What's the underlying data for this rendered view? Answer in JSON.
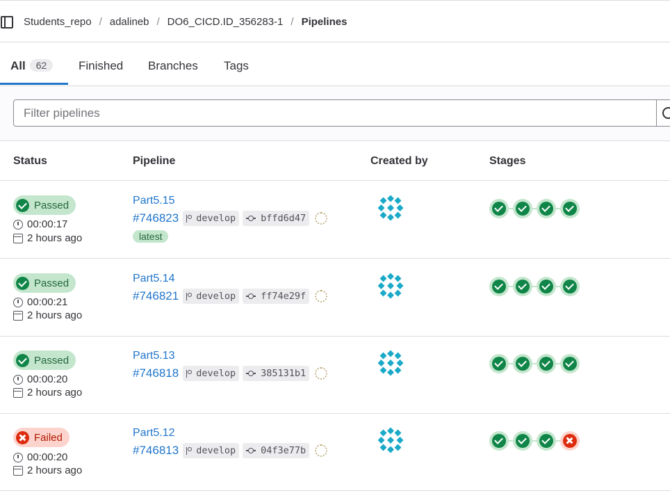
{
  "breadcrumb": {
    "items": [
      "Students_repo",
      "adalineb",
      "DO6_CICD.ID_356283-1",
      "Pipelines"
    ]
  },
  "tabs": {
    "all_label": "All",
    "all_count": "62",
    "finished_label": "Finished",
    "branches_label": "Branches",
    "tags_label": "Tags"
  },
  "filter": {
    "placeholder": "Filter pipelines"
  },
  "table": {
    "headers": [
      "Status",
      "Pipeline",
      "Created by",
      "Stages"
    ]
  },
  "colors": {
    "link": "#1f75cb",
    "success": "#108548",
    "danger": "#dd2b0e"
  },
  "pipelines": [
    {
      "status": "Passed",
      "duration": "00:00:17",
      "created": "2 hours ago",
      "name": "Part5.15",
      "id": "#746823",
      "branch": "develop",
      "commit": "bffd6d47",
      "tag": "latest",
      "stages": [
        "success",
        "success",
        "success",
        "success"
      ]
    },
    {
      "status": "Passed",
      "duration": "00:00:21",
      "created": "2 hours ago",
      "name": "Part5.14",
      "id": "#746821",
      "branch": "develop",
      "commit": "ff74e29f",
      "stages": [
        "success",
        "success",
        "success",
        "success"
      ]
    },
    {
      "status": "Passed",
      "duration": "00:00:20",
      "created": "2 hours ago",
      "name": "Part5.13",
      "id": "#746818",
      "branch": "develop",
      "commit": "385131b1",
      "stages": [
        "success",
        "success",
        "success",
        "success"
      ]
    },
    {
      "status": "Failed",
      "duration": "00:00:20",
      "created": "2 hours ago",
      "name": "Part5.12",
      "id": "#746813",
      "branch": "develop",
      "commit": "04f3e77b",
      "stages": [
        "success",
        "success",
        "success",
        "failed"
      ]
    }
  ]
}
